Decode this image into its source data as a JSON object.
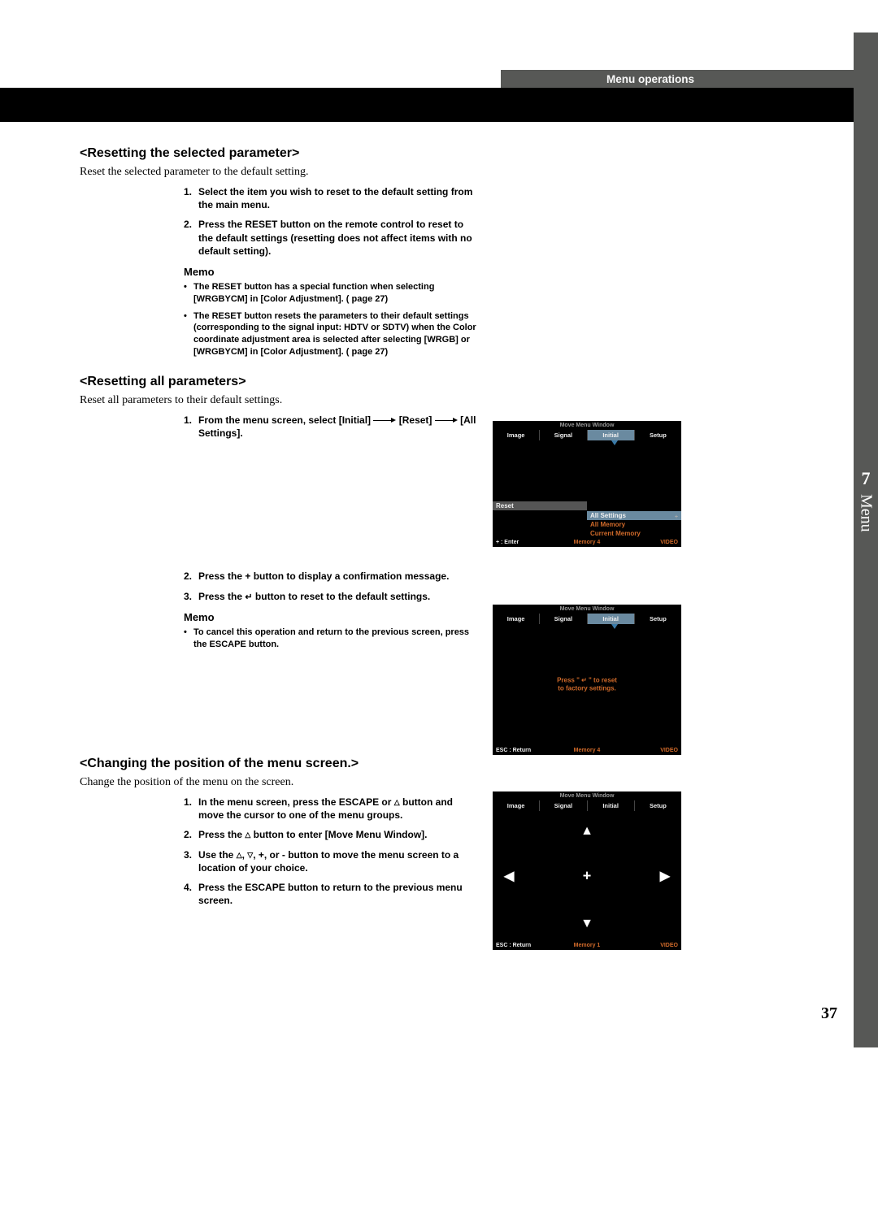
{
  "header": {
    "section_label": "Menu operations"
  },
  "side_tab": {
    "number": "7",
    "word": "Menu"
  },
  "page_number": "37",
  "sec1": {
    "title": "<Resetting the selected parameter>",
    "intro": "Reset the selected parameter to the default setting.",
    "steps": [
      "Select the item you wish to reset to the default setting from the main menu.",
      "Press the RESET button on the remote control to reset to the default settings (resetting does not affect items with no default setting)."
    ],
    "memo_head": "Memo",
    "memo": [
      "The RESET button has a special function when selecting [WRGBYCM] in [Color Adjustment]. (    page 27)",
      "The RESET button resets the parameters to their default settings (corresponding to the signal input: HDTV or SDTV) when the Color coordinate adjustment area is selected after selecting  [WRGB] or [WRGBYCM] in [Color Adjustment]. (    page 27)"
    ]
  },
  "sec2": {
    "title": "<Resetting all parameters>",
    "intro": "Reset all parameters to their default settings.",
    "step1_pre": "From the menu screen, select [Initial]",
    "step1_mid": "[Reset]",
    "step1_post": "[All Settings].",
    "step2": "Press the + button to display a confirmation message.",
    "step3_pre": "Press the ",
    "step3_post": " button to reset to the default settings.",
    "memo_head": "Memo",
    "memo1": "To cancel this operation and return to the previous screen, press the ESCAPE button."
  },
  "sec3": {
    "title": "<Changing the position of the menu screen.>",
    "intro": "Change the position of the menu on the screen.",
    "step1_pre": "In the menu screen, press the ESCAPE or ",
    "step1_post": " button and move the cursor to one of the menu groups.",
    "step2_pre": "Press the ",
    "step2_post": " button to enter [Move Menu Window].",
    "step3_pre": "Use the ",
    "step3_post": ", +, or - button to move the menu screen to a location of your choice.",
    "step4": "Press the ESCAPE button to return to the previous menu screen."
  },
  "osd": {
    "move_bar": "Move Menu Window",
    "tabs": [
      "Image",
      "Signal",
      "Initial",
      "Setup"
    ],
    "reset_label": "Reset",
    "opts": [
      "All Settings",
      "All Memory",
      "Current Memory"
    ],
    "enter_hint": "+ : Enter",
    "esc_hint": "ESC : Return",
    "memory4": "Memory 4",
    "memory1": "Memory 1",
    "video": "VIDEO",
    "confirm_l1": "Press \" ↵ \" to reset",
    "confirm_l2": "to factory settings.",
    "plus_marker": "+"
  }
}
